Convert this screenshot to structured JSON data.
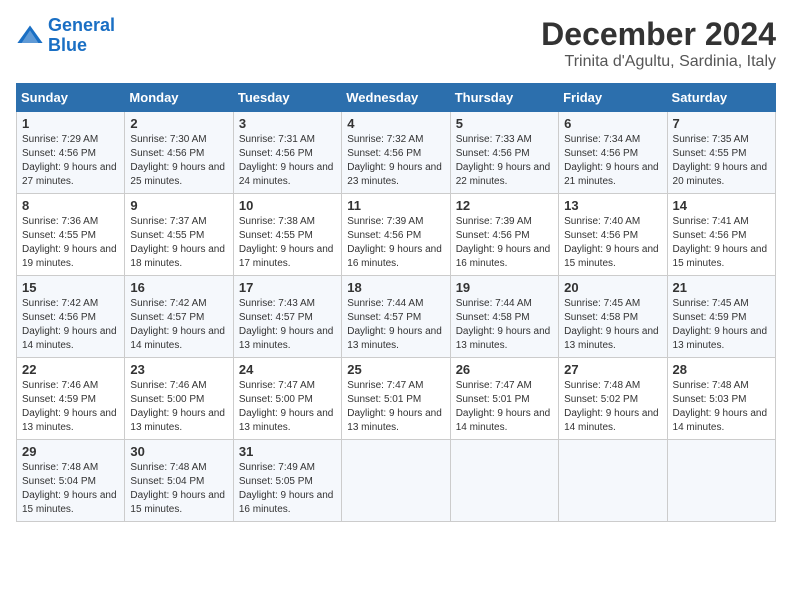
{
  "header": {
    "logo_line1": "General",
    "logo_line2": "Blue",
    "title": "December 2024",
    "subtitle": "Trinita d'Agultu, Sardinia, Italy"
  },
  "weekdays": [
    "Sunday",
    "Monday",
    "Tuesday",
    "Wednesday",
    "Thursday",
    "Friday",
    "Saturday"
  ],
  "weeks": [
    [
      {
        "day": "1",
        "sunrise": "Sunrise: 7:29 AM",
        "sunset": "Sunset: 4:56 PM",
        "daylight": "Daylight: 9 hours and 27 minutes."
      },
      {
        "day": "2",
        "sunrise": "Sunrise: 7:30 AM",
        "sunset": "Sunset: 4:56 PM",
        "daylight": "Daylight: 9 hours and 25 minutes."
      },
      {
        "day": "3",
        "sunrise": "Sunrise: 7:31 AM",
        "sunset": "Sunset: 4:56 PM",
        "daylight": "Daylight: 9 hours and 24 minutes."
      },
      {
        "day": "4",
        "sunrise": "Sunrise: 7:32 AM",
        "sunset": "Sunset: 4:56 PM",
        "daylight": "Daylight: 9 hours and 23 minutes."
      },
      {
        "day": "5",
        "sunrise": "Sunrise: 7:33 AM",
        "sunset": "Sunset: 4:56 PM",
        "daylight": "Daylight: 9 hours and 22 minutes."
      },
      {
        "day": "6",
        "sunrise": "Sunrise: 7:34 AM",
        "sunset": "Sunset: 4:56 PM",
        "daylight": "Daylight: 9 hours and 21 minutes."
      },
      {
        "day": "7",
        "sunrise": "Sunrise: 7:35 AM",
        "sunset": "Sunset: 4:55 PM",
        "daylight": "Daylight: 9 hours and 20 minutes."
      }
    ],
    [
      {
        "day": "8",
        "sunrise": "Sunrise: 7:36 AM",
        "sunset": "Sunset: 4:55 PM",
        "daylight": "Daylight: 9 hours and 19 minutes."
      },
      {
        "day": "9",
        "sunrise": "Sunrise: 7:37 AM",
        "sunset": "Sunset: 4:55 PM",
        "daylight": "Daylight: 9 hours and 18 minutes."
      },
      {
        "day": "10",
        "sunrise": "Sunrise: 7:38 AM",
        "sunset": "Sunset: 4:55 PM",
        "daylight": "Daylight: 9 hours and 17 minutes."
      },
      {
        "day": "11",
        "sunrise": "Sunrise: 7:39 AM",
        "sunset": "Sunset: 4:56 PM",
        "daylight": "Daylight: 9 hours and 16 minutes."
      },
      {
        "day": "12",
        "sunrise": "Sunrise: 7:39 AM",
        "sunset": "Sunset: 4:56 PM",
        "daylight": "Daylight: 9 hours and 16 minutes."
      },
      {
        "day": "13",
        "sunrise": "Sunrise: 7:40 AM",
        "sunset": "Sunset: 4:56 PM",
        "daylight": "Daylight: 9 hours and 15 minutes."
      },
      {
        "day": "14",
        "sunrise": "Sunrise: 7:41 AM",
        "sunset": "Sunset: 4:56 PM",
        "daylight": "Daylight: 9 hours and 15 minutes."
      }
    ],
    [
      {
        "day": "15",
        "sunrise": "Sunrise: 7:42 AM",
        "sunset": "Sunset: 4:56 PM",
        "daylight": "Daylight: 9 hours and 14 minutes."
      },
      {
        "day": "16",
        "sunrise": "Sunrise: 7:42 AM",
        "sunset": "Sunset: 4:57 PM",
        "daylight": "Daylight: 9 hours and 14 minutes."
      },
      {
        "day": "17",
        "sunrise": "Sunrise: 7:43 AM",
        "sunset": "Sunset: 4:57 PM",
        "daylight": "Daylight: 9 hours and 13 minutes."
      },
      {
        "day": "18",
        "sunrise": "Sunrise: 7:44 AM",
        "sunset": "Sunset: 4:57 PM",
        "daylight": "Daylight: 9 hours and 13 minutes."
      },
      {
        "day": "19",
        "sunrise": "Sunrise: 7:44 AM",
        "sunset": "Sunset: 4:58 PM",
        "daylight": "Daylight: 9 hours and 13 minutes."
      },
      {
        "day": "20",
        "sunrise": "Sunrise: 7:45 AM",
        "sunset": "Sunset: 4:58 PM",
        "daylight": "Daylight: 9 hours and 13 minutes."
      },
      {
        "day": "21",
        "sunrise": "Sunrise: 7:45 AM",
        "sunset": "Sunset: 4:59 PM",
        "daylight": "Daylight: 9 hours and 13 minutes."
      }
    ],
    [
      {
        "day": "22",
        "sunrise": "Sunrise: 7:46 AM",
        "sunset": "Sunset: 4:59 PM",
        "daylight": "Daylight: 9 hours and 13 minutes."
      },
      {
        "day": "23",
        "sunrise": "Sunrise: 7:46 AM",
        "sunset": "Sunset: 5:00 PM",
        "daylight": "Daylight: 9 hours and 13 minutes."
      },
      {
        "day": "24",
        "sunrise": "Sunrise: 7:47 AM",
        "sunset": "Sunset: 5:00 PM",
        "daylight": "Daylight: 9 hours and 13 minutes."
      },
      {
        "day": "25",
        "sunrise": "Sunrise: 7:47 AM",
        "sunset": "Sunset: 5:01 PM",
        "daylight": "Daylight: 9 hours and 13 minutes."
      },
      {
        "day": "26",
        "sunrise": "Sunrise: 7:47 AM",
        "sunset": "Sunset: 5:01 PM",
        "daylight": "Daylight: 9 hours and 14 minutes."
      },
      {
        "day": "27",
        "sunrise": "Sunrise: 7:48 AM",
        "sunset": "Sunset: 5:02 PM",
        "daylight": "Daylight: 9 hours and 14 minutes."
      },
      {
        "day": "28",
        "sunrise": "Sunrise: 7:48 AM",
        "sunset": "Sunset: 5:03 PM",
        "daylight": "Daylight: 9 hours and 14 minutes."
      }
    ],
    [
      {
        "day": "29",
        "sunrise": "Sunrise: 7:48 AM",
        "sunset": "Sunset: 5:04 PM",
        "daylight": "Daylight: 9 hours and 15 minutes."
      },
      {
        "day": "30",
        "sunrise": "Sunrise: 7:48 AM",
        "sunset": "Sunset: 5:04 PM",
        "daylight": "Daylight: 9 hours and 15 minutes."
      },
      {
        "day": "31",
        "sunrise": "Sunrise: 7:49 AM",
        "sunset": "Sunset: 5:05 PM",
        "daylight": "Daylight: 9 hours and 16 minutes."
      },
      null,
      null,
      null,
      null
    ]
  ]
}
